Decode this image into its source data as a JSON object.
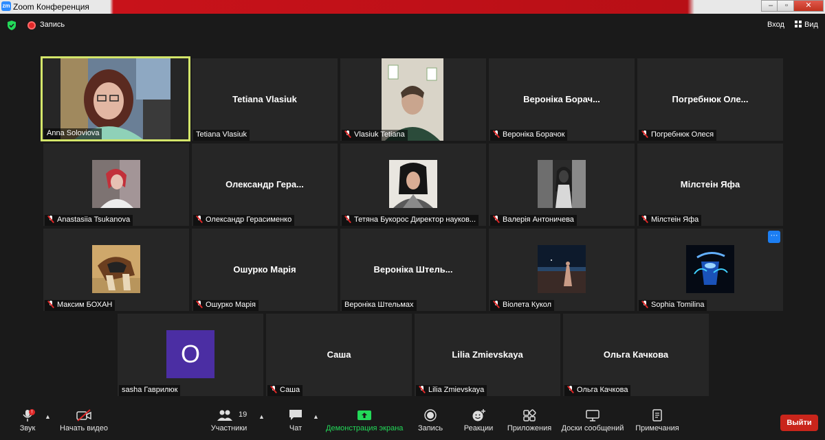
{
  "window": {
    "app_badge": "zm",
    "title": "Zoom Конференция"
  },
  "topbar": {
    "recording_label": "Запись",
    "signin_label": "Вход",
    "view_label": "Вид"
  },
  "tiles": [
    {
      "label": "Anna Soloviova",
      "muted": false,
      "active": true
    },
    {
      "big_name": "Tetiana Vlasiuk",
      "label": "Tetiana Vlasiuk",
      "muted": false
    },
    {
      "label": "Vlasiuk Tetiana",
      "muted": true
    },
    {
      "big_name": "Вероніка Борач...",
      "label": "Вероніка Борачок",
      "muted": true
    },
    {
      "big_name": "Погребнюк Оле...",
      "label": "Погребнюк Олеся",
      "muted": true
    },
    {
      "label": "Anastasiia Tsukanova",
      "muted": true
    },
    {
      "big_name": "Олександр Гера...",
      "label": "Олександр Герасименко",
      "muted": true
    },
    {
      "label": "Тетяна Букорос Директор науков...",
      "muted": true
    },
    {
      "label": "Валерія Антоничева",
      "muted": true
    },
    {
      "big_name": "Мілстеін Яфа",
      "label": "Мілстеін Яфа",
      "muted": true
    },
    {
      "label": "Максим БОХАН",
      "muted": true
    },
    {
      "big_name": "Ошурко Марія",
      "label": "Ошурко Марія",
      "muted": true
    },
    {
      "big_name": "Вероніка Штель...",
      "label": "Вероніка Штельмах",
      "muted": false
    },
    {
      "label": "Віолета Кукол",
      "muted": true
    },
    {
      "label": "Sophia Tomilina",
      "muted": true,
      "more_button": "···"
    },
    {
      "avatar_letter": "O",
      "label": "sasha Гаврилюк",
      "muted": false
    },
    {
      "big_name": "Саша",
      "label": "Саша",
      "muted": true
    },
    {
      "big_name": "Lilia Zmievskaya",
      "label": "Lilia Zmievskaya",
      "muted": true
    },
    {
      "big_name": "Ольга Качкова",
      "label": "Ольга Качкова",
      "muted": true
    }
  ],
  "toolbar": {
    "audio": "Звук",
    "audio_badge": "!",
    "video": "Начать видео",
    "participants": "Участники",
    "participants_count": "19",
    "chat": "Чат",
    "share": "Демонстрация экрана",
    "record": "Запись",
    "reactions": "Реакции",
    "apps": "Приложения",
    "whiteboards": "Доски сообщений",
    "notes": "Примечания",
    "leave": "Выйти"
  },
  "colors": {
    "accent_green": "#23d959",
    "leave_red": "#c9251b",
    "active_speaker": "#d4e66a"
  }
}
